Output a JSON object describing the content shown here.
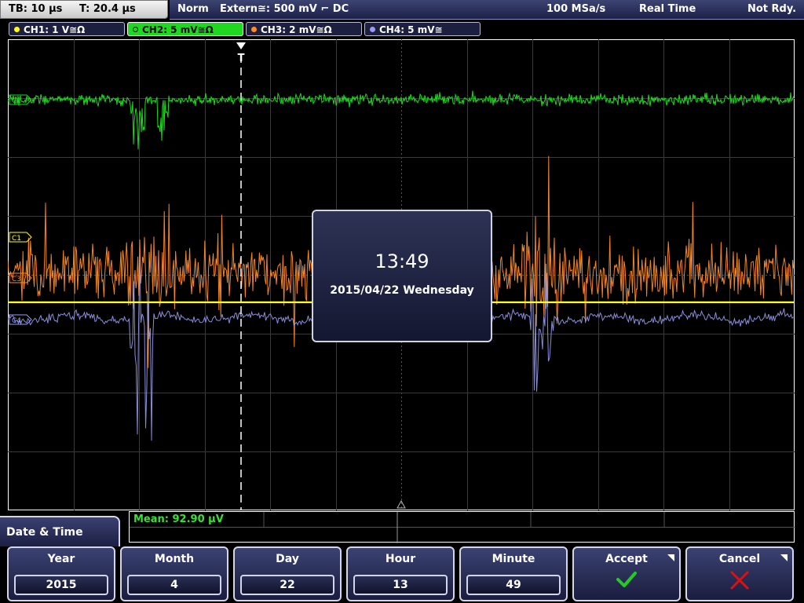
{
  "header": {
    "timebase": "TB: 10 µs",
    "trigger_time": "T: 20.4 µs",
    "trigger_mode": "Norm",
    "trigger_source": "Extern≅: 500 mV ⌐ DC",
    "sample_rate": "100 MSa/s",
    "acq_mode": "Real Time",
    "status": "Not Rdy."
  },
  "channels": [
    {
      "label": "CH1: 1 V≅Ω",
      "color": "#ffff1a"
    },
    {
      "label": "CH2: 5 mV≅Ω",
      "color": "#1fd81f"
    },
    {
      "label": "CH3: 2 mV≅Ω",
      "color": "#ff8c2a"
    },
    {
      "label": "CH4: 5 mV≅",
      "color": "#9a9cf2"
    }
  ],
  "markers": {
    "ch1": "C1",
    "ch2": "C2",
    "ch3": "C3",
    "ch4": "C4",
    "trigger": "T"
  },
  "popup": {
    "time": "13:49",
    "date": "2015/04/22 Wednesday"
  },
  "measurement": {
    "mean": "Mean: 92.90 µV"
  },
  "menu": {
    "title": "Date & Time",
    "year": {
      "label": "Year",
      "value": "2015"
    },
    "month": {
      "label": "Month",
      "value": "4"
    },
    "day": {
      "label": "Day",
      "value": "22"
    },
    "hour": {
      "label": "Hour",
      "value": "13"
    },
    "minute": {
      "label": "Minute",
      "value": "49"
    },
    "accept": {
      "label": "Accept",
      "icon": "checkmark-icon"
    },
    "cancel": {
      "label": "Cancel",
      "icon": "cross-icon"
    }
  }
}
